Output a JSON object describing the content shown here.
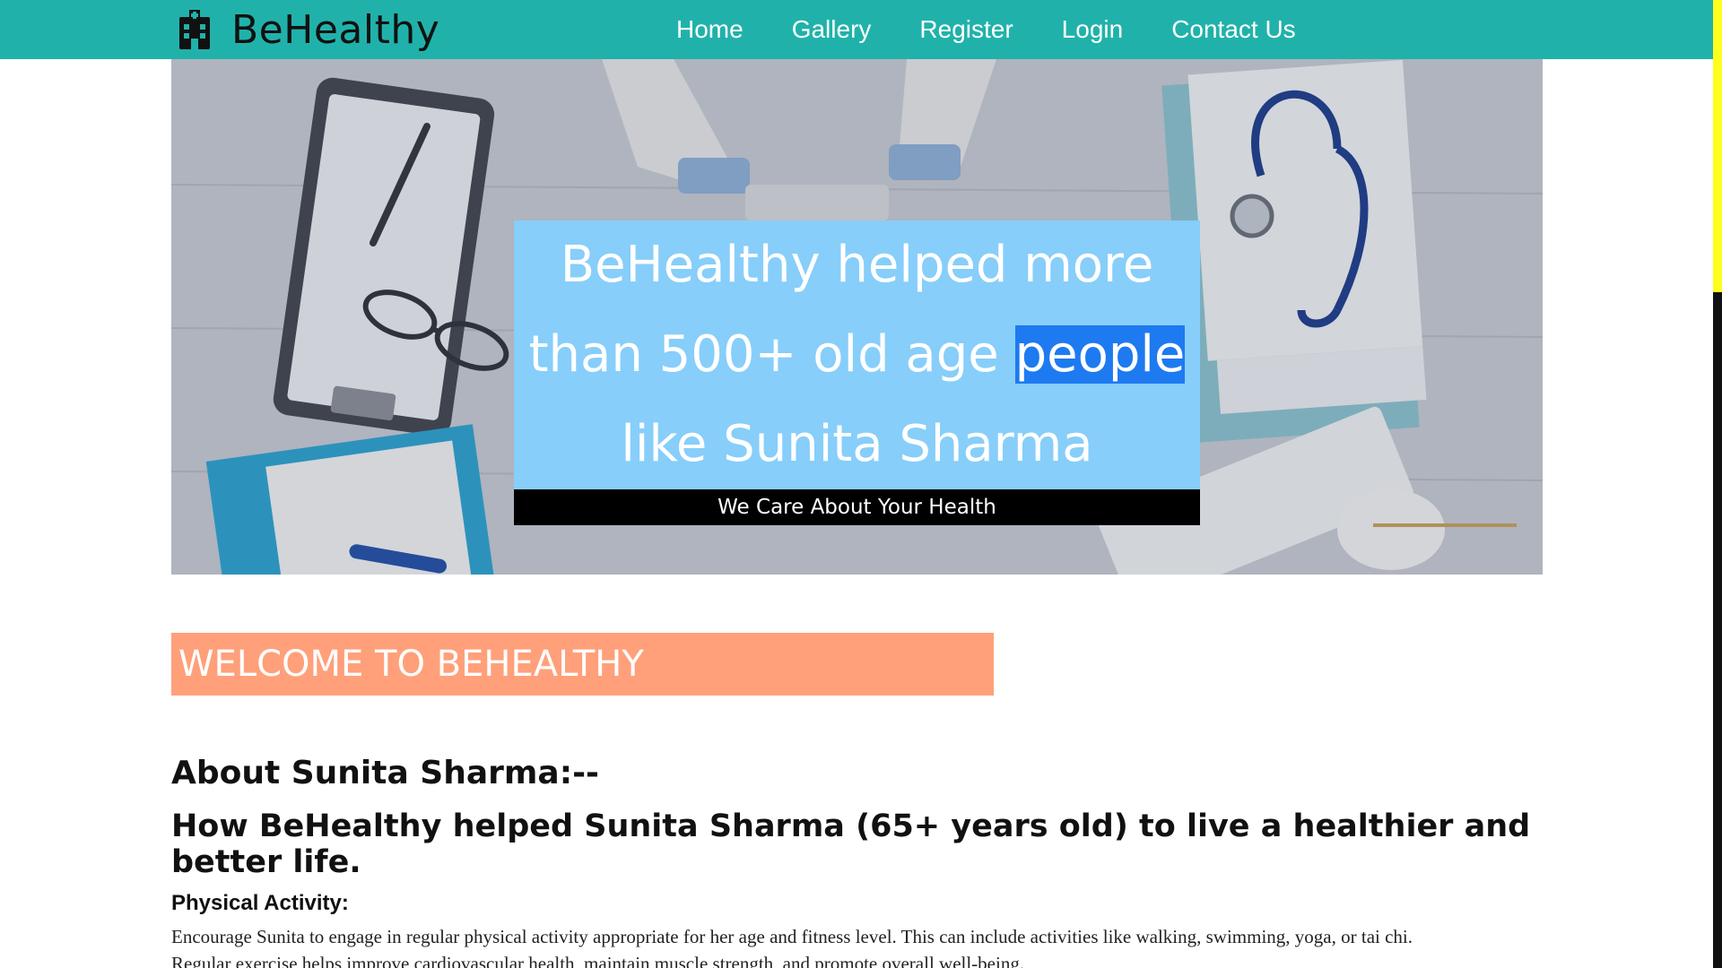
{
  "colors": {
    "navbar": "#20b2aa",
    "hero_card": "#87cefa",
    "hero_highlight": "#1e7af0",
    "welcome_banner": "#ffa07a",
    "scrollbar_track": "#ffff1f",
    "scrollbar_thumb": "#111111"
  },
  "header": {
    "brand_icon": "hospital-icon",
    "brand_name": "BeHealthy",
    "nav": [
      "Home",
      "Gallery",
      "Register",
      "Login",
      "Contact Us"
    ]
  },
  "hero": {
    "headline_before": "BeHealthy helped more than 500+ old age",
    "headline_highlight": "people",
    "headline_after": "like Sunita Sharma",
    "tagline": "We Care About Your Health"
  },
  "welcome": {
    "title": "WELCOME TO BEHEALTHY"
  },
  "about": {
    "title": "About Sunita Sharma:--",
    "subtitle": "How BeHealthy helped Sunita Sharma (65+ years old) to live a healthier and better life."
  },
  "sections": [
    {
      "heading": "Physical Activity:",
      "body_line_1": "Encourage Sunita to engage in regular physical activity appropriate for her age and fitness level. This can include activities like walking, swimming, yoga, or tai chi.",
      "body_line_2": "Regular exercise helps improve cardiovascular health, maintain muscle strength, and promote overall well-being."
    }
  ]
}
